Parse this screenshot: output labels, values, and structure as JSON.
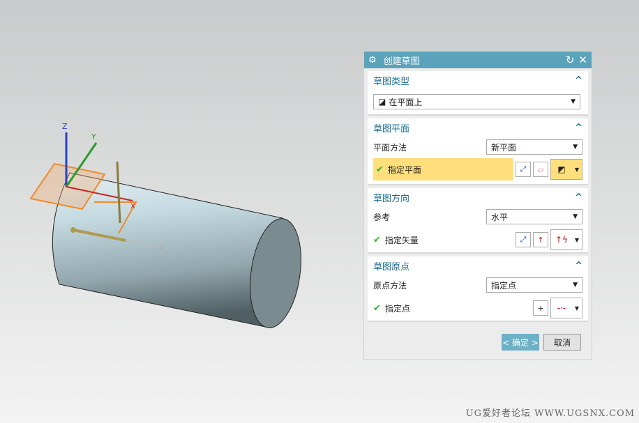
{
  "dialog": {
    "title": "创建草图",
    "reset_icon": "reset-icon",
    "close_icon": "close-icon",
    "sections": {
      "type": {
        "title": "草图类型",
        "value": "在平面上"
      },
      "plane": {
        "title": "草图平面",
        "method_label": "平面方法",
        "method_value": "新平面",
        "specify_label": "指定平面"
      },
      "orient": {
        "title": "草图方向",
        "ref_label": "参考",
        "ref_value": "水平",
        "specify_label": "指定矢量"
      },
      "origin": {
        "title": "草图原点",
        "method_label": "原点方法",
        "method_value": "指定点",
        "specify_label": "指定点"
      }
    },
    "ok_label": "< 确定 >",
    "cancel_label": "取消"
  },
  "scene": {
    "axis_labels": {
      "z": "Z",
      "y": "Y",
      "x": "X",
      "x2": "X"
    }
  },
  "watermark": "UG爱好者论坛 WWW.UGSNX.COM",
  "colors": {
    "title_bar": "#5ba3bd",
    "highlight": "#fedf7c",
    "accent_text": "#1c6e91"
  }
}
